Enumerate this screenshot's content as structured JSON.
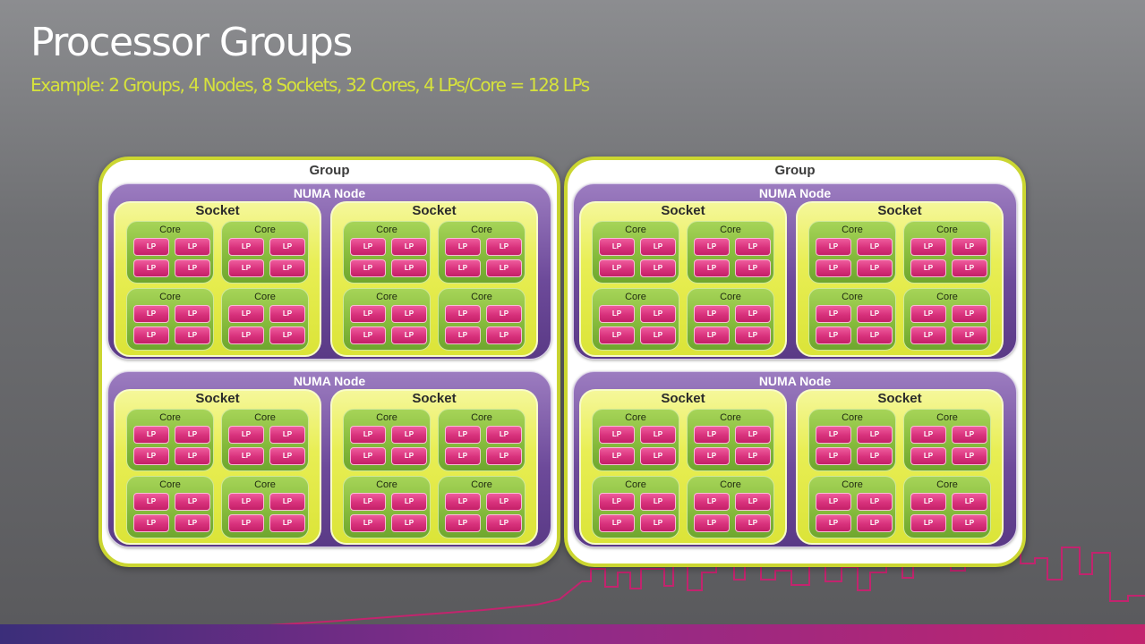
{
  "slide": {
    "title": "Processor Groups",
    "subtitle": "Example: 2 Groups, 4 Nodes, 8 Sockets, 32 Cores, 4 LPs/Core = 128 LPs"
  },
  "labels": {
    "group": "Group",
    "numa_node": "NUMA Node",
    "socket": "Socket",
    "core": "Core",
    "lp": "LP"
  },
  "colors": {
    "group_border": "#cbd631",
    "numa_node": "#6d4a9a",
    "socket": "#e8ee54",
    "core": "#86bb3c",
    "lp": "#d8317c",
    "subtitle": "#d6e23c",
    "skyline": "#c2246e"
  },
  "structure": {
    "groups": 2,
    "numa_nodes_per_group": 2,
    "sockets_per_node": 2,
    "cores_per_socket": 4,
    "lps_per_core": 4
  }
}
